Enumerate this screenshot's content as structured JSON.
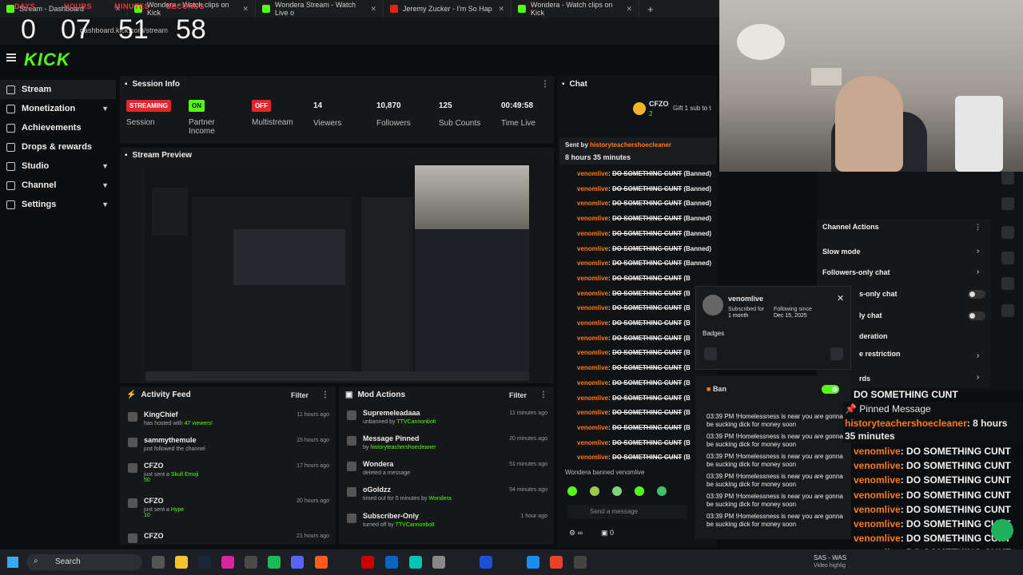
{
  "browser": {
    "tabs": [
      {
        "label": "Stream - Dashboard",
        "icon": "kick-icon"
      },
      {
        "label": "Wondera - Watch clips on Kick",
        "icon": "kick-icon"
      },
      {
        "label": "Wondera Stream - Watch Live o",
        "icon": "kick-icon"
      },
      {
        "label": "Jeremy Zucker - I'm So Hap",
        "icon": "youtube-icon"
      },
      {
        "label": "Wondera - Watch clips on Kick",
        "icon": "kick-icon"
      }
    ],
    "url": "dashboard.kick.com/stream"
  },
  "timer": {
    "days_label": "DAYS",
    "hours_label": "HOURS",
    "minutes_label": "MINUTES",
    "seconds_label": "SECONDS",
    "days": "0",
    "hours": "07",
    "minutes": "51",
    "seconds": "58"
  },
  "brand": {
    "logo": "KICK",
    "accent": "#53fc18"
  },
  "sidebar": {
    "items": [
      {
        "label": "Stream",
        "icon": "broadcast-icon",
        "expand": false
      },
      {
        "label": "Monetization",
        "icon": "money-icon",
        "expand": true
      },
      {
        "label": "Achievements",
        "icon": "trophy-icon",
        "expand": false
      },
      {
        "label": "Drops & rewards",
        "icon": "gift-icon",
        "expand": false
      },
      {
        "label": "Studio",
        "icon": "studio-icon",
        "expand": true
      },
      {
        "label": "Channel",
        "icon": "channel-icon",
        "expand": true
      },
      {
        "label": "Settings",
        "icon": "gear-icon",
        "expand": true
      }
    ]
  },
  "session": {
    "title": "Session Info",
    "status_badge": "STREAMING",
    "status_label": "Session",
    "partner_badge": "ON",
    "partner_label": "Partner Income",
    "multistream_badge": "OFF",
    "multistream_label": "Multistream",
    "viewers": "14",
    "viewers_label": "Viewers",
    "followers": "10,870",
    "followers_label": "Followers",
    "subs": "125",
    "subs_label": "Sub Counts",
    "time": "00:49:58",
    "time_label": "Time Live"
  },
  "preview": {
    "title": "Stream Preview"
  },
  "activity": {
    "title": "Activity Feed",
    "filter": "Filter",
    "items": [
      {
        "name": "KingChief",
        "pre": "has hosted with ",
        "hl": "47 viewers!",
        "ago": "11 hours ago"
      },
      {
        "name": "sammythemule",
        "pre": "just followed the channel",
        "hl": "",
        "ago": "15 hours ago"
      },
      {
        "name": "CFZO",
        "pre": "just sent a ",
        "hl": "Skull Emoji",
        "ago": "17 hours ago"
      },
      {
        "name": "CFZO",
        "pre": "just sent a ",
        "hl": "Hype",
        "ago": "20 hours ago"
      },
      {
        "name": "CFZO",
        "pre": "",
        "hl": "",
        "ago": "21 hours ago"
      }
    ],
    "kicks": [
      "50",
      "10"
    ]
  },
  "mod": {
    "title": "Mod Actions",
    "filter": "Filter",
    "items": [
      {
        "name": "Supremeleadaaa",
        "pre": "unbanned by ",
        "hl": "TTVCannonbolt",
        "ago": "11 minutes ago"
      },
      {
        "name": "Message Pinned",
        "pre": "by ",
        "hl": "historyteachershoecleaner",
        "ago": "20 minutes ago"
      },
      {
        "name": "Wondera",
        "pre": "deleted a message",
        "hl": "",
        "ago": "51 minutes ago"
      },
      {
        "name": "oGoldzz",
        "pre": "timed out for 5 minutes by ",
        "hl": "Wondera",
        "ago": "54 minutes ago"
      },
      {
        "name": "Subscriber-Only",
        "pre": "turned off by ",
        "hl": "TTVCannonbolt",
        "ago": "1 hour ago"
      }
    ]
  },
  "chat": {
    "title": "Chat",
    "top_gifter": "CFZO",
    "gifter_count": "2",
    "gift_text": "Gift 1 sub to t",
    "sent_by_label": "Sent by",
    "sent_by_user": "historyteachershoecleaner",
    "sent_time": "8 hours 35 minutes",
    "banned_user": "venomlive",
    "banned_msg": "DO SOMETHING CUNT",
    "banned_suffix": "(Banned)",
    "banned_suffix_cut": "(B",
    "status_line": "Wondera banned venomlive",
    "send_placeholder": "Send a message",
    "viewer_count": "0"
  },
  "user_card": {
    "username": "venomlive",
    "subscribed_label": "Subscribed for",
    "subscribed_value": "1 month",
    "following_label": "Following since",
    "following_value": "Dec 15, 2025",
    "badges_label": "Badges",
    "ban_label": "Ban",
    "history_time": "03:39 PM",
    "history_msg": "!Homelessness is near you are gonna be sucking dick for money soon"
  },
  "channel_actions": {
    "title": "Channel Actions",
    "rows": [
      "Slow mode",
      "Followers-only chat",
      "s-only chat",
      "ly chat",
      "deration",
      "e restriction",
      "rds"
    ]
  },
  "overlay_chat": {
    "pinned_label": "Pinned Message",
    "pinned_user": "historyteachershoecleaner",
    "pinned_time_a": ": 8 hours",
    "pinned_time_b": "35 minutes",
    "top_line": "DO SOMETHING CUNT",
    "user": "venomlive",
    "msg": "DO SOMETHING CUNT"
  },
  "taskbar": {
    "search": "Search",
    "tray_title": "SAS - WAS",
    "tray_sub": "Video highlig"
  }
}
